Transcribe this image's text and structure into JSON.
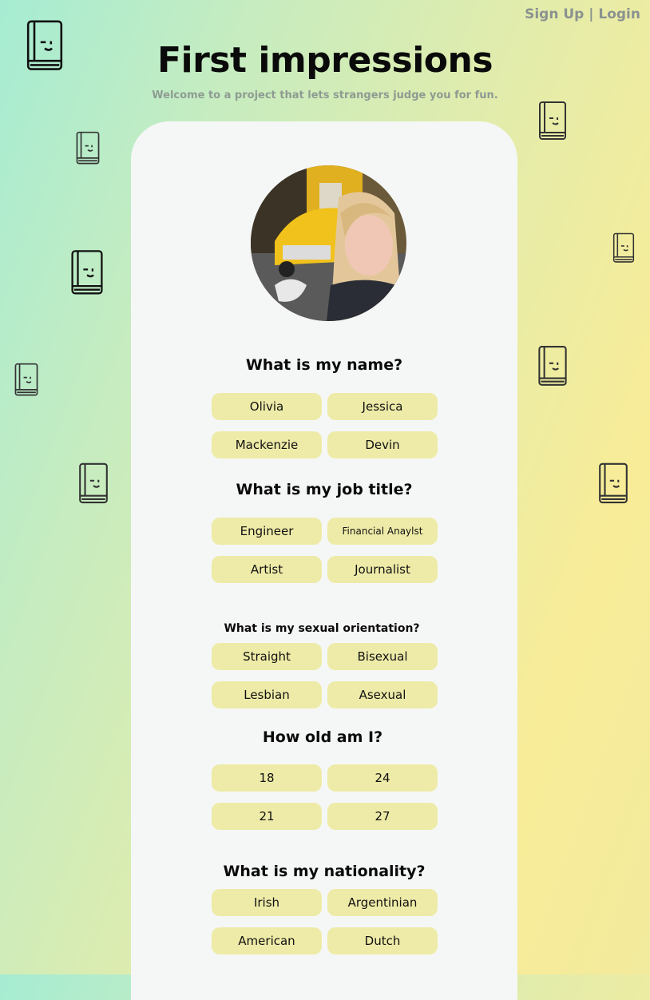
{
  "nav": {
    "signup": "Sign Up",
    "separator": "|",
    "login": "Login"
  },
  "header": {
    "title": "First impressions",
    "subtitle": "Welcome to a project that lets strangers judge you for fun."
  },
  "colors": {
    "button_bg": "#eeeba8",
    "card_bg": "#f5f7f6",
    "nav_text": "#8a9290"
  },
  "profile": {
    "avatar_icon": "profile-photo"
  },
  "questions": [
    {
      "text": "What is my name?",
      "options": [
        "Olivia",
        "Jessica",
        "Mackenzie",
        "Devin"
      ]
    },
    {
      "text": "What is my job title?",
      "options": [
        "Engineer",
        "Financial Anaylst",
        "Artist",
        "Journalist"
      ]
    },
    {
      "text": "What is my sexual orientation?",
      "options": [
        "Straight",
        "Bisexual",
        "Lesbian",
        "Asexual"
      ]
    },
    {
      "text": "How old am I?",
      "options": [
        "18",
        "24",
        "21",
        "27"
      ]
    },
    {
      "text": "What is my nationality?",
      "options": [
        "Irish",
        "Argentinian",
        "American",
        "Dutch"
      ]
    }
  ],
  "decorations": {
    "icon": "book-face-icon"
  }
}
